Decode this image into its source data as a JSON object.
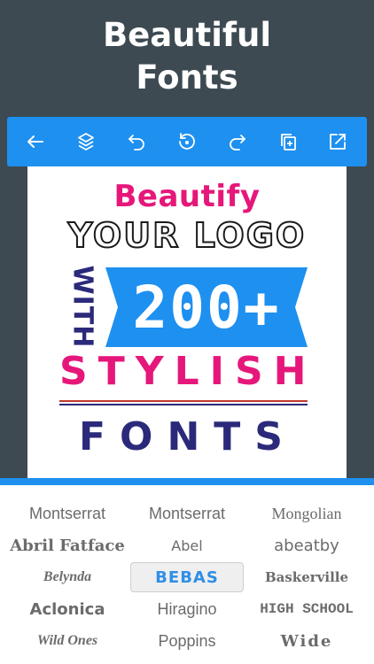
{
  "headline": {
    "line1": "Beautiful",
    "line2": "Fonts"
  },
  "toolbar": {
    "items": [
      {
        "icon": "back-arrow-icon"
      },
      {
        "icon": "layers-icon"
      },
      {
        "icon": "undo-icon"
      },
      {
        "icon": "reset-icon"
      },
      {
        "icon": "redo-icon"
      },
      {
        "icon": "duplicate-icon"
      },
      {
        "icon": "export-icon"
      }
    ]
  },
  "canvas": {
    "line1": "Beautify",
    "line2": "YOUR LOGO",
    "side": "WITH",
    "banner": "200+",
    "line4": "STYLISH",
    "line5": "FONTS",
    "colors": {
      "pink": "#e6177a",
      "navy": "#2b2a7a",
      "blue": "#1e90f0"
    }
  },
  "font_picker": {
    "options": [
      "Montserrat",
      "Montserrat",
      "Mongolian",
      "Abril Fatface",
      "Abel",
      "abeatby",
      "Belynda",
      "BEBAS",
      "Baskerville",
      "Aclonica",
      "Hiragino",
      "HIGH SCHOOL",
      "Wild Ones",
      "Poppins",
      "Wide"
    ],
    "selected": "BEBAS"
  },
  "accent": "#1e90f0"
}
